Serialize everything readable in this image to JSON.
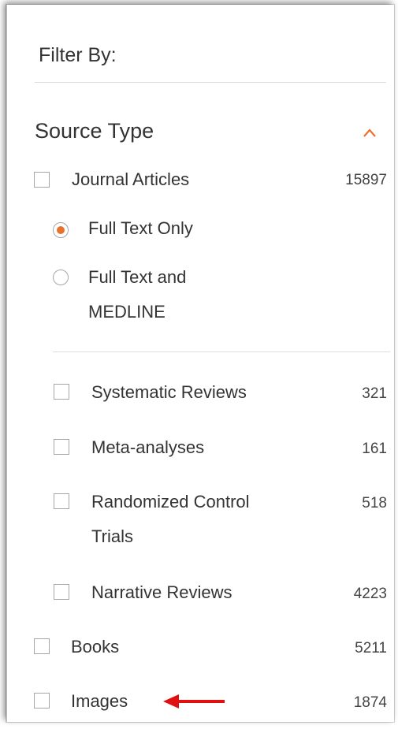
{
  "filter": {
    "heading": "Filter By:",
    "section": {
      "title": "Source Type",
      "collapse_icon": "chevron-up-icon",
      "accent_color": "#e8722c"
    },
    "journal_articles": {
      "label": "Journal Articles",
      "count": "15897",
      "checked": false
    },
    "full_text_options": [
      {
        "label": "Full Text Only",
        "selected": true
      },
      {
        "label_line1": "Full Text and",
        "label_line2": "MEDLINE",
        "selected": false
      }
    ],
    "sub_types": [
      {
        "label": "Systematic Reviews",
        "count": "321",
        "checked": false
      },
      {
        "label": "Meta-analyses",
        "count": "161",
        "checked": false
      },
      {
        "label_line1": "Randomized Control",
        "label_line2": "Trials",
        "count": "518",
        "checked": false
      },
      {
        "label": "Narrative Reviews",
        "count": "4223",
        "checked": false
      }
    ],
    "books": {
      "label": "Books",
      "count": "5211",
      "checked": false
    },
    "images": {
      "label": "Images",
      "count": "1874",
      "checked": false
    },
    "annotation_arrow": {
      "icon": "left-arrow-icon",
      "color": "#e01010"
    }
  }
}
